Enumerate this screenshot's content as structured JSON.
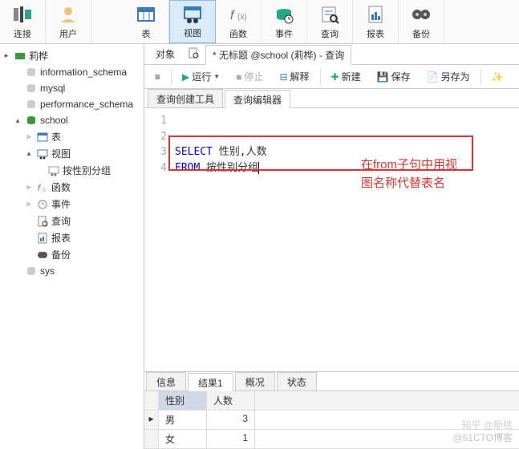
{
  "toolbar": {
    "items": [
      {
        "label": "连接",
        "icon": "link"
      },
      {
        "label": "用户",
        "icon": "user"
      },
      {
        "label": "表",
        "icon": "table"
      },
      {
        "label": "视图",
        "icon": "view",
        "active": true
      },
      {
        "label": "函数",
        "icon": "fx"
      },
      {
        "label": "事件",
        "icon": "event"
      },
      {
        "label": "查询",
        "icon": "query"
      },
      {
        "label": "报表",
        "icon": "report"
      },
      {
        "label": "备份",
        "icon": "backup"
      }
    ]
  },
  "tree": [
    {
      "level": 0,
      "expander": "▸",
      "icon": "conn",
      "label": "莉桦"
    },
    {
      "level": 1,
      "expander": "",
      "icon": "db",
      "label": "information_schema"
    },
    {
      "level": 1,
      "expander": "",
      "icon": "db",
      "label": "mysql"
    },
    {
      "level": 1,
      "expander": "",
      "icon": "db",
      "label": "performance_schema"
    },
    {
      "level": 1,
      "expander": "▴",
      "icon": "db-green",
      "label": "school"
    },
    {
      "level": 2,
      "expander": "▹",
      "icon": "table",
      "label": "表"
    },
    {
      "level": 2,
      "expander": "▴",
      "icon": "view",
      "label": "视图"
    },
    {
      "level": 3,
      "expander": "",
      "icon": "view",
      "label": "按性别分组"
    },
    {
      "level": 2,
      "expander": "▹",
      "icon": "fx",
      "label": "函数"
    },
    {
      "level": 2,
      "expander": "▹",
      "icon": "event",
      "label": "事件"
    },
    {
      "level": 2,
      "expander": "",
      "icon": "query",
      "label": "查询"
    },
    {
      "level": 2,
      "expander": "",
      "icon": "report",
      "label": "报表"
    },
    {
      "level": 2,
      "expander": "",
      "icon": "backup",
      "label": "备份"
    },
    {
      "level": 1,
      "expander": "",
      "icon": "db",
      "label": "sys"
    }
  ],
  "tabs": {
    "object": "对象",
    "current_prefix": "* 无标题 @school (莉桦) - 查询",
    "dirty_icon": "•"
  },
  "actions": {
    "menu": "≡",
    "run": "运行",
    "stop": "停止",
    "explain": "解释",
    "new": "新建",
    "save": "保存",
    "saveas": "另存为"
  },
  "subtabs": {
    "builder": "查询创建工具",
    "editor": "查询编辑器"
  },
  "sql": {
    "lines": [
      "1",
      "2",
      "3",
      "4"
    ],
    "select_kw": "SELECT",
    "select_cols": "性别,人数",
    "from_kw": "FROM",
    "from_tbl": "按性别分组"
  },
  "annotation": {
    "line1": "在from子句中用视",
    "line2": "图名称代替表名"
  },
  "result_tabs": {
    "info": "信息",
    "result1": "结果1",
    "profile": "概况",
    "status": "状态"
  },
  "grid": {
    "columns": [
      "性别",
      "人数"
    ],
    "rows": [
      {
        "c0": "男",
        "c1": "3",
        "current": true
      },
      {
        "c0": "女",
        "c1": "1"
      }
    ]
  },
  "watermark1": "知乎 @斯桃",
  "watermark2": "@51CTO博客"
}
